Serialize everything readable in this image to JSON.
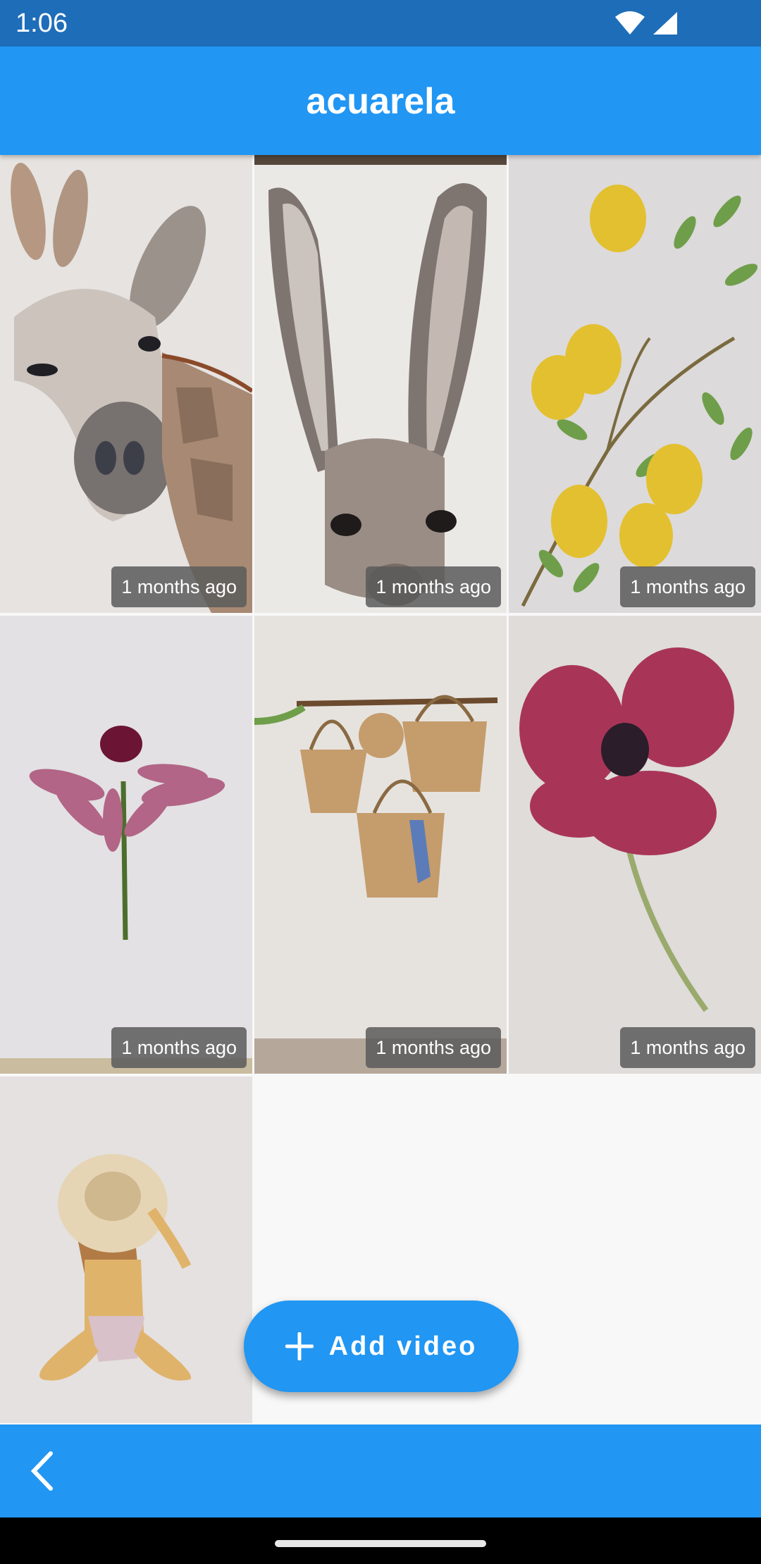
{
  "status_bar": {
    "time": "1:06",
    "icons": [
      "wifi-icon",
      "signal-icon"
    ]
  },
  "app_bar": {
    "title": "acuarela"
  },
  "videos": [
    {
      "subject": "giraffe",
      "age": "1 months ago"
    },
    {
      "subject": "hare",
      "age": "1 months ago"
    },
    {
      "subject": "lemons",
      "age": "1 months ago"
    },
    {
      "subject": "coneflower",
      "age": "1 months ago"
    },
    {
      "subject": "straw-baskets",
      "age": "1 months ago"
    },
    {
      "subject": "red-poppy",
      "age": "1 months ago"
    },
    {
      "subject": "girl-with-hat",
      "age": ""
    }
  ],
  "fab": {
    "label": "Add video",
    "icon": "plus-icon"
  },
  "bottom_bar": {
    "back_icon": "chevron-left-icon"
  },
  "colors": {
    "primary": "#2196f3",
    "status_bar": "#1e6db9",
    "badge": "#5a5a5a"
  }
}
